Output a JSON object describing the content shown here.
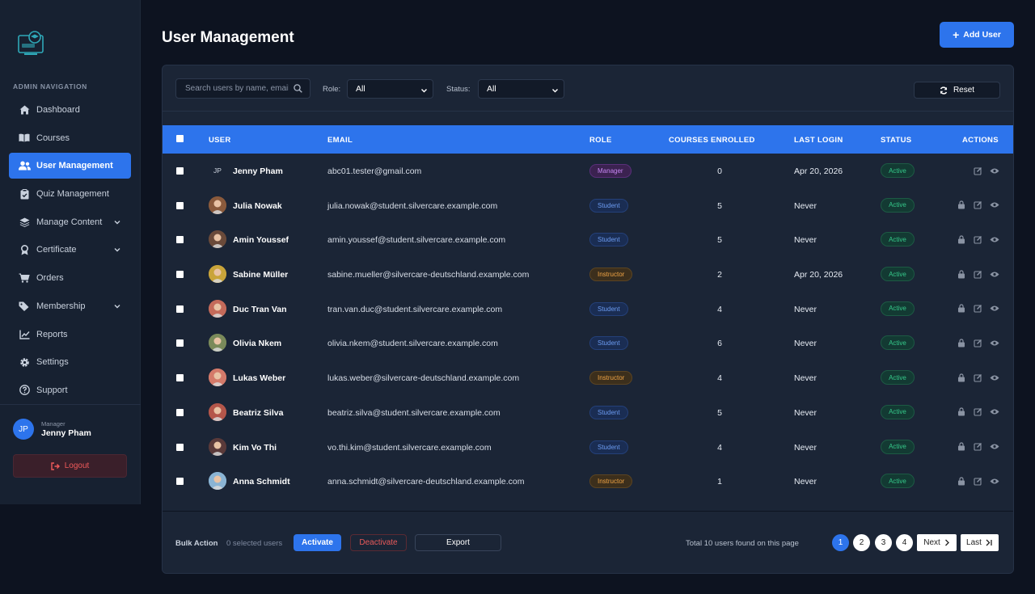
{
  "sidebar": {
    "nav_title": "ADMIN NAVIGATION",
    "items": [
      {
        "label": "Dashboard",
        "icon": "home-icon"
      },
      {
        "label": "Courses",
        "icon": "book-icon"
      },
      {
        "label": "User Management",
        "icon": "users-icon",
        "active": true
      },
      {
        "label": "Quiz Management",
        "icon": "clipboard-icon"
      },
      {
        "label": "Manage Content",
        "icon": "layers-icon",
        "expandable": true
      },
      {
        "label": "Certificate",
        "icon": "award-icon",
        "expandable": true
      },
      {
        "label": "Orders",
        "icon": "cart-icon"
      },
      {
        "label": "Membership",
        "icon": "tags-icon",
        "expandable": true
      },
      {
        "label": "Reports",
        "icon": "chart-line-icon"
      },
      {
        "label": "Settings",
        "icon": "gear-icon"
      },
      {
        "label": "Support",
        "icon": "question-circle-icon"
      }
    ],
    "profile": {
      "initials": "JP",
      "role": "Manager",
      "name": "Jenny Pham"
    },
    "logout_label": "Logout"
  },
  "header": {
    "title": "User Management",
    "add_user_label": "Add User"
  },
  "filters": {
    "search_placeholder": "Search users by name, email...",
    "role_label": "Role:",
    "role_value": "All",
    "status_label": "Status:",
    "status_value": "All",
    "reset_label": "Reset"
  },
  "table": {
    "headers": [
      "USER",
      "EMAIL",
      "ROLE",
      "COURSES ENROLLED",
      "LAST LOGIN",
      "STATUS",
      "ACTIONS"
    ],
    "rows": [
      {
        "name": "Jenny Pham",
        "initials": "JP",
        "email": "abc01.tester@gmail.com",
        "role": "Manager",
        "courses": "0",
        "last_login": "Apr 20, 2026",
        "status": "Active",
        "avatar_color": "#1b2536"
      },
      {
        "name": "Julia Nowak",
        "initials": "",
        "email": "julia.nowak@student.silvercare.example.com",
        "role": "Student",
        "courses": "5",
        "last_login": "Never",
        "status": "Active",
        "avatar_color": "#8a5a3c"
      },
      {
        "name": "Amin Youssef",
        "initials": "",
        "email": "amin.youssef@student.silvercare.example.com",
        "role": "Student",
        "courses": "5",
        "last_login": "Never",
        "status": "Active",
        "avatar_color": "#6a4a3a"
      },
      {
        "name": "Sabine Müller",
        "initials": "",
        "email": "sabine.mueller@silvercare-deutschland.example.com",
        "role": "Instructor",
        "courses": "2",
        "last_login": "Apr 20, 2026",
        "status": "Active",
        "avatar_color": "#c9a43a"
      },
      {
        "name": "Duc Tran Van",
        "initials": "",
        "email": "tran.van.duc@student.silvercare.example.com",
        "role": "Student",
        "courses": "4",
        "last_login": "Never",
        "status": "Active",
        "avatar_color": "#c46a5a"
      },
      {
        "name": "Olivia Nkem",
        "initials": "",
        "email": "olivia.nkem@student.silvercare.example.com",
        "role": "Student",
        "courses": "6",
        "last_login": "Never",
        "status": "Active",
        "avatar_color": "#7a8a5a"
      },
      {
        "name": "Lukas Weber",
        "initials": "",
        "email": "lukas.weber@silvercare-deutschland.example.com",
        "role": "Instructor",
        "courses": "4",
        "last_login": "Never",
        "status": "Active",
        "avatar_color": "#d47a6a"
      },
      {
        "name": "Beatriz Silva",
        "initials": "",
        "email": "beatriz.silva@student.silvercare.example.com",
        "role": "Student",
        "courses": "5",
        "last_login": "Never",
        "status": "Active",
        "avatar_color": "#b4564a"
      },
      {
        "name": "Kim Vo Thi",
        "initials": "",
        "email": "vo.thi.kim@student.silvercare.example.com",
        "role": "Student",
        "courses": "4",
        "last_login": "Never",
        "status": "Active",
        "avatar_color": "#5a3a3a"
      },
      {
        "name": "Anna Schmidt",
        "initials": "",
        "email": "anna.schmidt@silvercare-deutschland.example.com",
        "role": "Instructor",
        "courses": "1",
        "last_login": "Never",
        "status": "Active",
        "avatar_color": "#8ab4d4"
      }
    ]
  },
  "footer": {
    "bulk_label": "Bulk Action",
    "selected_count": "0 selected users",
    "activate_label": "Activate",
    "deactivate_label": "Deactivate",
    "export_label": "Export",
    "total_text": "Total 10 users found on this page",
    "pages": [
      "1",
      "2",
      "3",
      "4"
    ],
    "current_page": "1",
    "next_label": "Next",
    "last_label": "Last"
  },
  "colors": {
    "accent": "#2d74ec",
    "background": "#0d1320",
    "panel": "#1b2536",
    "success": "#35c98a",
    "danger": "#ef5a5a"
  }
}
